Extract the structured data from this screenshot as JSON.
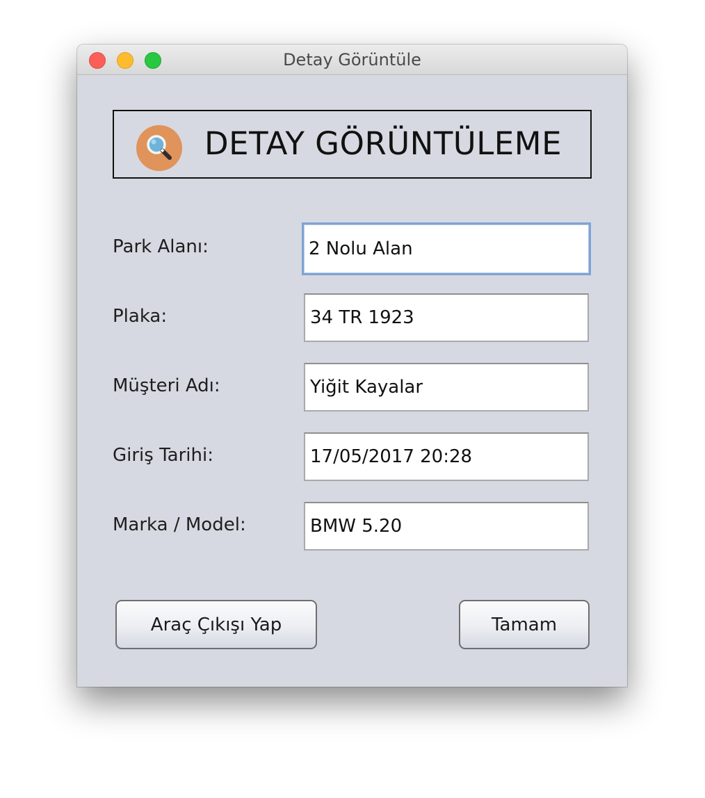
{
  "window": {
    "title": "Detay Görüntüle",
    "controls": [
      "close",
      "minimize",
      "zoom"
    ]
  },
  "header": {
    "icon": "magnifier-icon",
    "title": "DETAY GÖRÜNTÜLEME"
  },
  "form": {
    "fields": [
      {
        "label": "Park Alanı:",
        "value": "2 Nolu Alan",
        "focused": true
      },
      {
        "label": "Plaka:",
        "value": "34 TR 1923"
      },
      {
        "label": "Müşteri Adı:",
        "value": "Yiğit Kayalar"
      },
      {
        "label": "Giriş Tarihi:",
        "value": "17/05/2017 20:28"
      },
      {
        "label": "Marka / Model:",
        "value": "BMW 5.20"
      }
    ]
  },
  "buttons": {
    "exit_label": "Araç Çıkışı Yap",
    "ok_label": "Tamam"
  },
  "colors": {
    "window_bg": "#d6d9e1",
    "icon_circle": "#e0935a",
    "icon_lens": "#6fb3d9",
    "focus_ring": "#7ea4d4",
    "close": "#fc5f57",
    "minimize": "#fdbc2e",
    "zoom": "#28c840"
  }
}
